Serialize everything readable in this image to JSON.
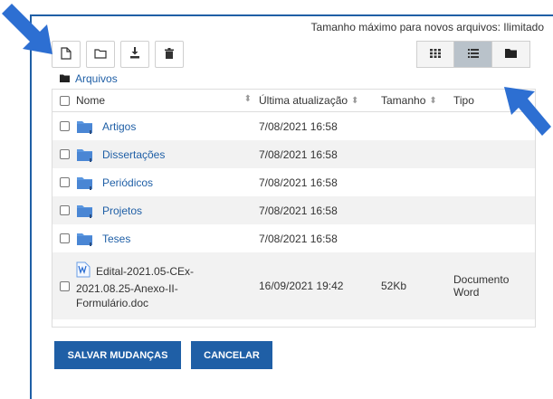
{
  "header": {
    "max_size_text": "Tamanho máximo para novos arquivos: Ilimitado"
  },
  "toolbar": {
    "buttons": [
      {
        "icon": "new-file-icon"
      },
      {
        "icon": "new-folder-icon"
      },
      {
        "icon": "download-icon"
      },
      {
        "icon": "trash-icon"
      }
    ]
  },
  "views": {
    "buttons": [
      {
        "icon": "grid-view-icon",
        "active": false
      },
      {
        "icon": "list-view-icon",
        "active": true
      },
      {
        "icon": "tree-view-icon",
        "active": false
      }
    ]
  },
  "breadcrumb": {
    "label": "Arquivos"
  },
  "table": {
    "columns": {
      "name": "Nome",
      "date": "Última atualização",
      "size": "Tamanho",
      "type": "Tipo"
    },
    "rows": [
      {
        "name": "Artigos",
        "date": "7/08/2021 16:58",
        "size": "",
        "type": ""
      },
      {
        "name": "Dissertações",
        "date": "7/08/2021 16:58",
        "size": "",
        "type": ""
      },
      {
        "name": "Periódicos",
        "date": "7/08/2021 16:58",
        "size": "",
        "type": ""
      },
      {
        "name": "Projetos",
        "date": "7/08/2021 16:58",
        "size": "",
        "type": ""
      },
      {
        "name": "Teses",
        "date": "7/08/2021 16:58",
        "size": "",
        "type": ""
      }
    ],
    "file": {
      "name_line1": "Edital-2021.05-CEx-",
      "name_line2": "2021.08.25-Anexo-II-",
      "name_line3": "Formulário.doc",
      "date": "16/09/2021 19:42",
      "size": "52Kb",
      "type_line1": "Documento",
      "type_line2": "Word"
    }
  },
  "actions": {
    "save": "SALVAR MUDANÇAS",
    "cancel": "CANCELAR"
  },
  "colors": {
    "accent": "#1f5fa6",
    "arrow": "#2d6fd2",
    "folder": "#5b97e0"
  }
}
